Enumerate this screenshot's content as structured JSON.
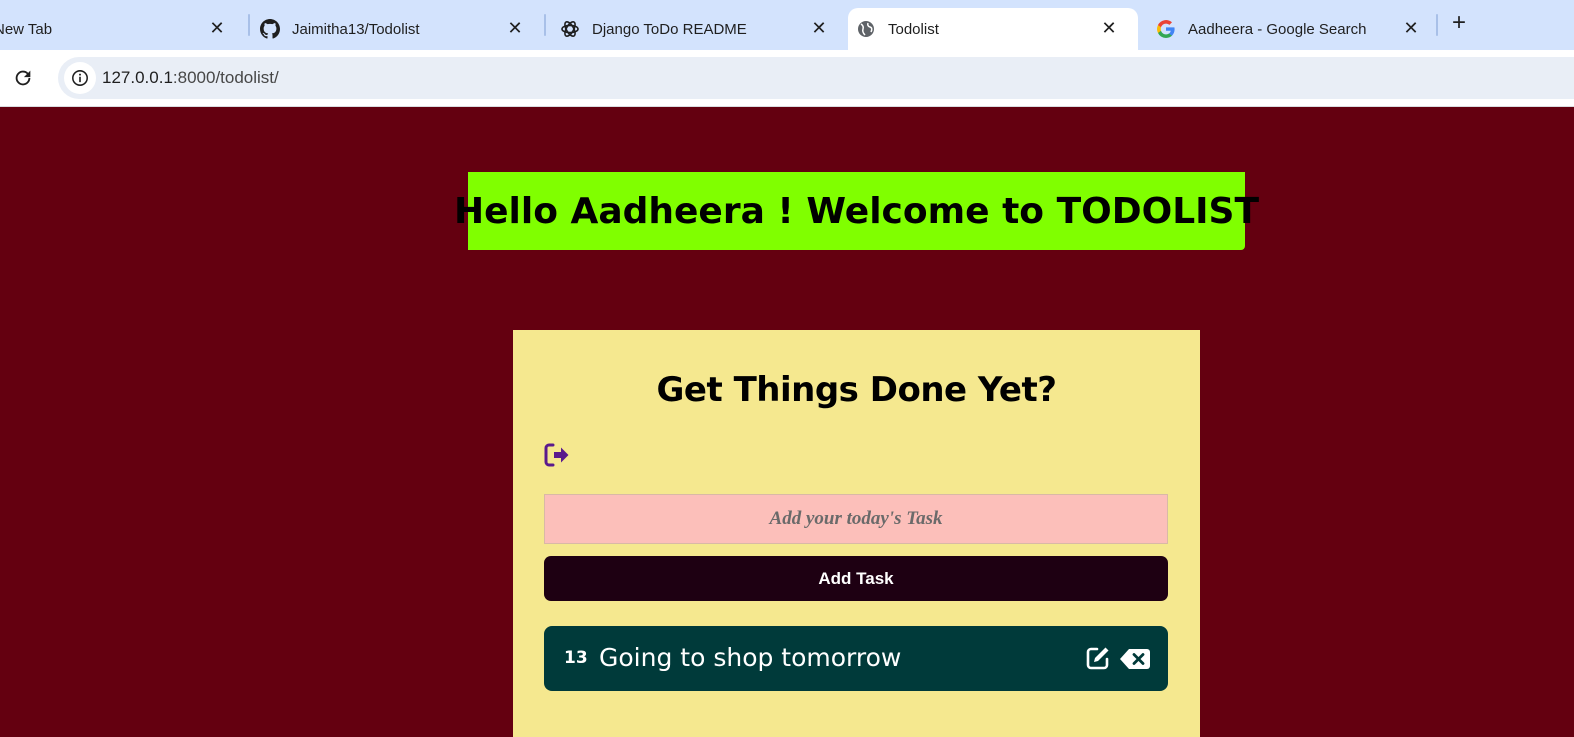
{
  "browser": {
    "tabs": [
      {
        "title": "New Tab",
        "icon": "none",
        "active": false
      },
      {
        "title": "Jaimitha13/Todolist",
        "icon": "github-icon",
        "active": false
      },
      {
        "title": "Django ToDo README",
        "icon": "openai-icon",
        "active": false
      },
      {
        "title": "Todolist",
        "icon": "globe-icon",
        "active": true
      },
      {
        "title": "Aadheera - Google Search",
        "icon": "google-icon",
        "active": false
      }
    ],
    "close_glyph": "✕",
    "new_tab_glyph": "+",
    "url_host": "127.0.0.1",
    "url_path": ":8000/todolist/"
  },
  "page": {
    "welcome": "Hello Aadheera ! Welcome to TODOLIST",
    "card_title": "Get Things Done Yet?",
    "logout_icon": "sign-out-icon",
    "input_placeholder": "Add your today's Task",
    "add_button": "Add Task",
    "tasks": [
      {
        "id": "13",
        "text": "Going to shop tomorrow"
      }
    ]
  },
  "colors": {
    "page_background": "#640010",
    "welcome_background": "#80ff00",
    "card_background": "#f5e88f",
    "input_background": "#fcbfba",
    "button_background": "#1e0012",
    "task_background": "#003a3a",
    "logout_icon": "#5a1a8c"
  }
}
